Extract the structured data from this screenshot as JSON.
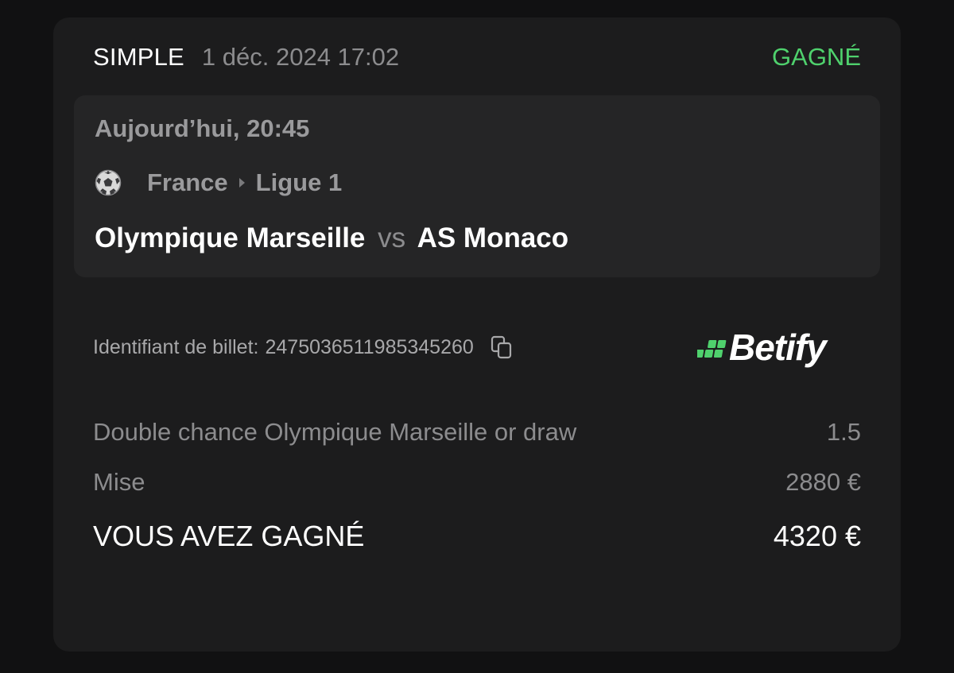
{
  "ticket": {
    "type": "SIMPLE",
    "date": "1 déc. 2024 17:02",
    "status": "GAGNÉ",
    "status_color": "#4fd16d"
  },
  "event": {
    "time": "Aujourd’hui, 20:45",
    "sport_icon": "soccer-ball-icon",
    "country": "France",
    "league": "Ligue 1",
    "home_team": "Olympique Marseille",
    "vs": "vs",
    "away_team": "AS Monaco"
  },
  "ticket_id": {
    "label": "Identifiant de billet:",
    "value": "2475036511985345260",
    "icon": "copy-icon"
  },
  "brand": {
    "name": "Betify",
    "accent": "#4fd16d"
  },
  "selection": {
    "label": "Double chance Olympique Marseille or draw",
    "odds": "1.5"
  },
  "stake": {
    "label": "Mise",
    "value": "2880 €"
  },
  "winnings": {
    "label": "VOUS AVEZ GAGNÉ",
    "value": "4320 €"
  }
}
